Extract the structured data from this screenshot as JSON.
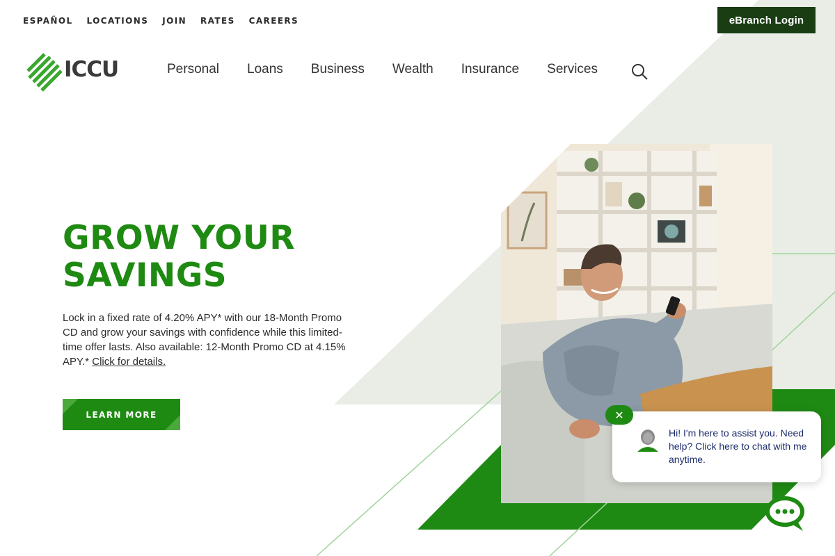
{
  "utility_nav": [
    "ESPAÑOL",
    "LOCATIONS",
    "JOIN",
    "RATES",
    "CAREERS"
  ],
  "ebranch_label": "eBranch Login",
  "logo_text": "ICCU",
  "main_nav": [
    "Personal",
    "Loans",
    "Business",
    "Wealth",
    "Insurance",
    "Services"
  ],
  "hero": {
    "title_line1": "GROW YOUR",
    "title_line2": "SAVINGS",
    "body": "Lock in a fixed rate of 4.20% APY* with our 18-Month Promo CD and grow your savings with confidence while this limited-time offer lasts. Also available: 12-Month Promo CD at 4.15% APY.*",
    "details_link": "Click for details.",
    "cta_label": "LEARN MORE"
  },
  "chat": {
    "message": "Hi! I'm here to assist you. Need help? Click here to chat with me anytime.",
    "close_label": "✕"
  },
  "colors": {
    "brand_green": "#1e8a12",
    "dark_green": "#1a3d14",
    "light_bg": "#e9ede6",
    "chat_text": "#1c2c6b"
  },
  "icons": [
    "search-icon",
    "close-icon",
    "chat-icon",
    "avatar-icon",
    "logo-icon"
  ]
}
